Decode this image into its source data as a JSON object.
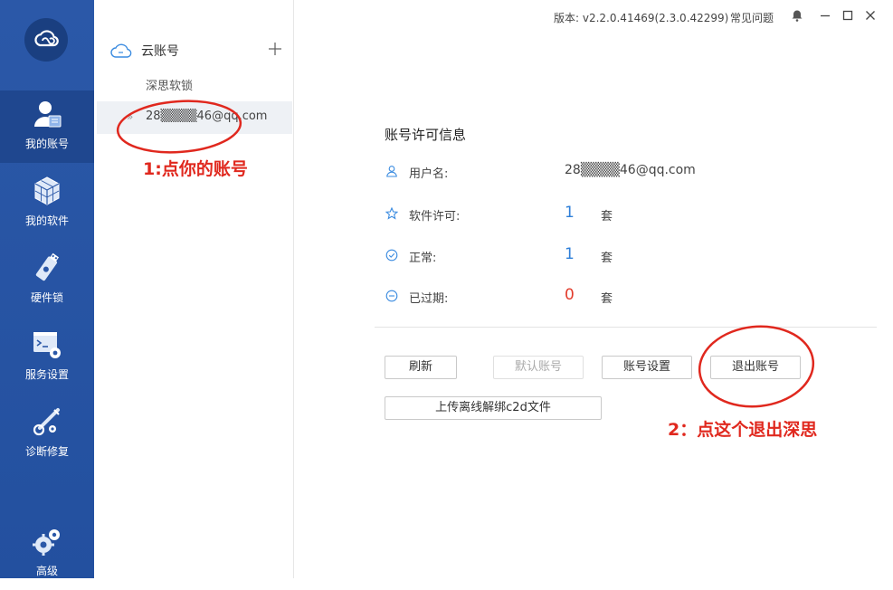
{
  "topbar": {
    "version": "版本: v2.2.0.41469(2.3.0.42299)",
    "faq": "常见问题"
  },
  "nav": {
    "items": [
      {
        "label": "我的账号",
        "icon": "user-account-icon"
      },
      {
        "label": "我的软件",
        "icon": "software-cubes-icon"
      },
      {
        "label": "硬件锁",
        "icon": "usb-dongle-icon"
      },
      {
        "label": "服务设置",
        "icon": "service-settings-icon"
      },
      {
        "label": "诊断修复",
        "icon": "diagnose-repair-icon"
      },
      {
        "label": "高级",
        "icon": "advanced-gears-icon"
      }
    ]
  },
  "accounts": {
    "header": "云账号",
    "items": [
      {
        "label": "深思软锁"
      },
      {
        "label": "28▒▒▒▒46@qq.com"
      }
    ]
  },
  "panel": {
    "title": "账号许可信息",
    "rows": [
      {
        "label": "用户名:",
        "value": "28▒▒▒▒46@qq.com",
        "icon": "user-outline-icon"
      },
      {
        "label": "软件许可:",
        "value": "1",
        "unit": "套",
        "icon": "star-outline-icon"
      },
      {
        "label": "正常:",
        "value": "1",
        "unit": "套",
        "icon": "check-circle-icon"
      },
      {
        "label": "已过期:",
        "value": "0",
        "unit": "套",
        "icon": "minus-circle-icon"
      }
    ],
    "buttons": {
      "refresh": "刷新",
      "default_account": "默认账号",
      "account_settings": "账号设置",
      "logout": "退出账号",
      "upload_c2d": "上传离线解绑c2d文件"
    }
  },
  "annotations": {
    "step1": "1:点你的账号",
    "step2": "2：点这个退出深思"
  },
  "colors": {
    "nav_bg": "#2b58a8",
    "accent_blue": "#2f7fd8",
    "expired_red": "#e23c2c",
    "annotation_red": "#e0281e"
  }
}
